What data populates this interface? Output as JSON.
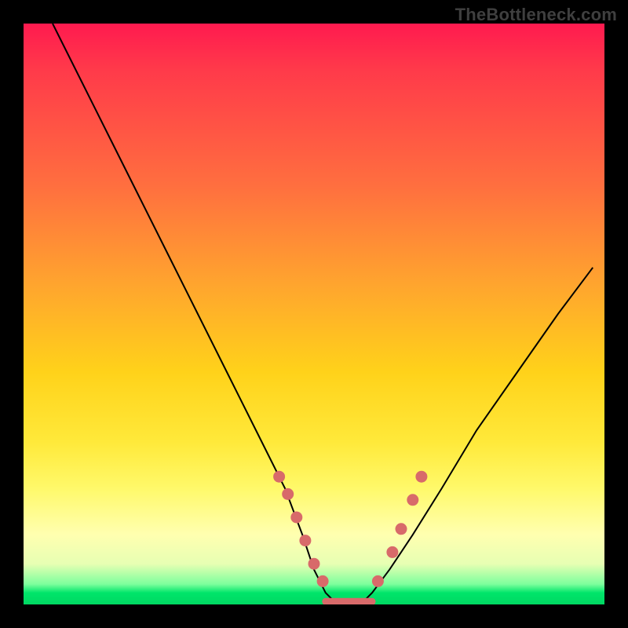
{
  "watermark": "TheBottleneck.com",
  "chart_data": {
    "type": "line",
    "title": "",
    "xlabel": "",
    "ylabel": "",
    "xlim": [
      0,
      100
    ],
    "ylim": [
      0,
      100
    ],
    "grid": false,
    "legend": false,
    "series": [
      {
        "name": "bottleneck-curve",
        "x": [
          5,
          10,
          15,
          20,
          25,
          30,
          35,
          40,
          45,
          48,
          50,
          52,
          54,
          56,
          58,
          60,
          63,
          67,
          72,
          78,
          85,
          92,
          98
        ],
        "y": [
          100,
          90,
          80,
          70,
          60,
          50,
          40,
          30,
          20,
          12,
          6,
          2,
          0,
          0,
          0,
          2,
          6,
          12,
          20,
          30,
          40,
          50,
          58
        ]
      }
    ],
    "markers": {
      "name": "highlighted-points",
      "color": "#d86a6a",
      "points": [
        {
          "x": 44,
          "y": 22
        },
        {
          "x": 45.5,
          "y": 19
        },
        {
          "x": 47,
          "y": 15
        },
        {
          "x": 48.5,
          "y": 11
        },
        {
          "x": 50,
          "y": 7
        },
        {
          "x": 51.5,
          "y": 4
        },
        {
          "x": 61,
          "y": 4
        },
        {
          "x": 63.5,
          "y": 9
        },
        {
          "x": 65,
          "y": 13
        },
        {
          "x": 67,
          "y": 18
        },
        {
          "x": 68.5,
          "y": 22
        }
      ],
      "flat_segment": {
        "x_start": 52,
        "x_end": 60,
        "y": 0.5
      }
    },
    "annotations": []
  }
}
